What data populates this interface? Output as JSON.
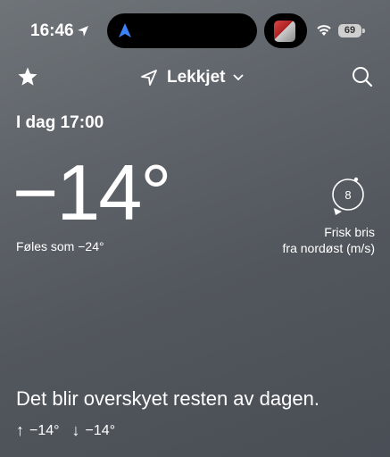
{
  "status_bar": {
    "time": "16:46",
    "battery": "69",
    "icons": [
      "location-arrow-icon",
      "navigation-icon",
      "app-thumbnail",
      "wifi-icon",
      "battery-icon"
    ]
  },
  "header": {
    "location": "Lekkjet",
    "icons": [
      "star-icon",
      "location-icon",
      "chevron-down-icon",
      "search-icon"
    ]
  },
  "current": {
    "datetime": "I dag 17:00",
    "temperature": "−14°",
    "feels_like": "Føles som −24°"
  },
  "wind": {
    "speed": "8",
    "description_line1": "Frisk bris",
    "description_line2": "fra nordøst (m/s)"
  },
  "forecast": {
    "text": "Det blir overskyet resten av dagen.",
    "max": "−14°",
    "min": "−14°"
  }
}
